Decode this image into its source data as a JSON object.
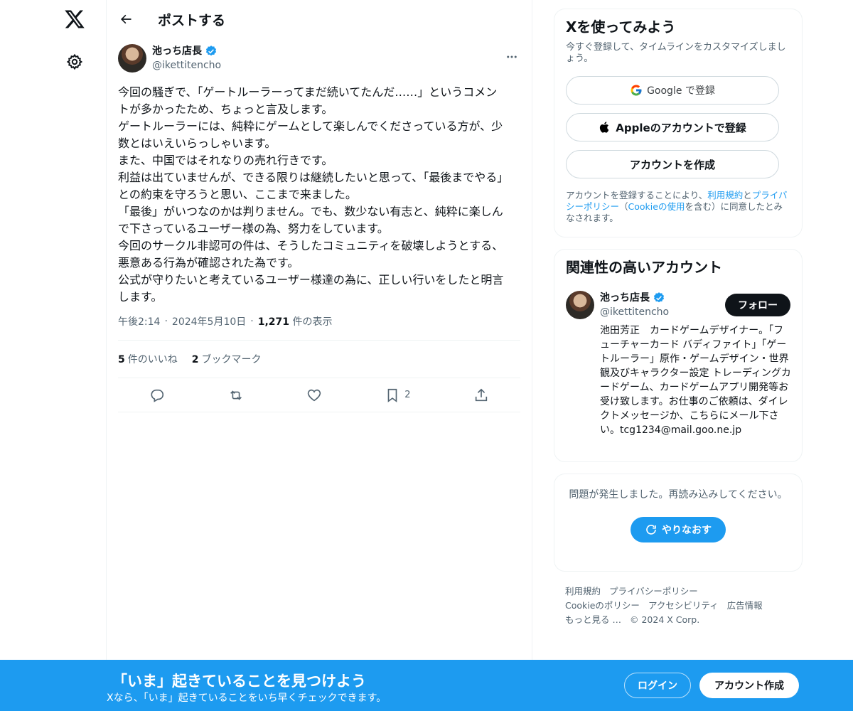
{
  "nav": {
    "logo_icon": "x-logo-icon",
    "settings_icon": "gear-icon"
  },
  "header": {
    "back_icon": "arrow-left-icon",
    "title": "ポストする"
  },
  "post": {
    "author_name": "池っち店長",
    "author_handle": "@ikettitencho",
    "verified": true,
    "text": "今回の騒ぎで、「ゲートルーラーってまだ続いてたんだ……」というコメントが多かったため、ちょっと言及します。\nゲートルーラーには、純粋にゲームとして楽しんでくださっている方が、少数とはいえいらっしゃいます。\nまた、中国ではそれなりの売れ行きです。\n利益は出ていませんが、できる限りは継続したいと思って、「最後までやる」との約束を守ろうと思い、ここまで来ました。\n「最後」がいつなのかは判りません。でも、数少ない有志と、純粋に楽しんで下さっているユーザー様の為、努力をしています。\n今回のサークル非認可の件は、そうしたコミュニティを破壊しようとする、悪意ある行為が確認された為です。\n公式が守りたいと考えているユーザー様達の為に、正しい行いをしたと明言します。",
    "time": "午後2:14",
    "sep": "·",
    "date": "2024年5月10日",
    "views_count": "1,271",
    "views_label": "件の表示",
    "likes_count": "5",
    "likes_label": "件のいいね",
    "bookmarks_count": "2",
    "bookmarks_label": "ブックマーク",
    "bookmark_action_count": "2"
  },
  "signup_card": {
    "title": "Xを使ってみよう",
    "subtitle": "今すぐ登録して、タイムラインをカスタマイズしましょう。",
    "google_label": "Google で登録",
    "apple_label": "Appleのアカウントで登録",
    "create_label": "アカウントを作成",
    "legal_prefix": "アカウントを登録することにより、",
    "legal_terms": "利用規約",
    "legal_and": "と",
    "legal_privacy": "プライバシーポリシー",
    "legal_paren_open": "（",
    "legal_cookie": "Cookieの使用",
    "legal_suffix": "を含む）に同意したとみなされます。"
  },
  "related": {
    "title": "関連性の高いアカウント",
    "name": "池っち店長",
    "handle": "@ikettitencho",
    "follow_label": "フォロー",
    "bio": "池田芳正　カードゲームデザイナー。「フューチャーカード バディファイト」「ゲートルーラー」原作・ゲームデザイン・世界観及びキャラクター設定 トレーディングカードゲーム、カードゲームアプリ開発等お受け致します。お仕事のご依頼は、ダイレクトメッセージか、こちらにメール下さい。tcg1234@mail.goo.ne.jp"
  },
  "error_card": {
    "message": "問題が発生しました。再読み込みしてください。",
    "retry_label": "やりなおす"
  },
  "footer": {
    "terms": "利用規約",
    "privacy": "プライバシーポリシー",
    "cookie": "Cookieのポリシー",
    "accessibility": "アクセシビリティ",
    "ads": "広告情報",
    "more": "もっと見る …",
    "copyright": "© 2024 X Corp."
  },
  "bottom_bar": {
    "title": "「いま」起きていることを見つけよう",
    "subtitle": "Xなら、「いま」起きていることをいち早くチェックできます。",
    "login_label": "ログイン",
    "signup_label": "アカウント作成"
  },
  "colors": {
    "accent": "#1d9bf0",
    "text": "#0f1419",
    "muted": "#536471",
    "border": "#eff3f4"
  }
}
